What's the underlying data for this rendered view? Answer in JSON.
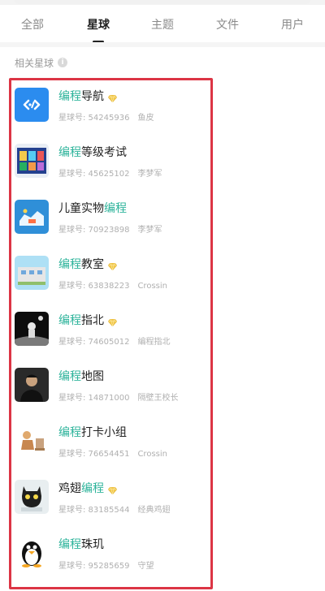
{
  "tabs": [
    {
      "label": "全部",
      "active": false
    },
    {
      "label": "星球",
      "active": true
    },
    {
      "label": "主题",
      "active": false
    },
    {
      "label": "文件",
      "active": false
    },
    {
      "label": "用户",
      "active": false
    }
  ],
  "section": {
    "title": "相关星球",
    "info_icon": "info-icon"
  },
  "keyword_color": "#2cb39a",
  "highlight_color": "#dc3545",
  "planets": [
    {
      "pre": "",
      "kw": "编程",
      "post": "导航",
      "diamond": true,
      "id_label": "星球号: 54245936",
      "owner": "鱼皮"
    },
    {
      "pre": "",
      "kw": "编程",
      "post": "等级考试",
      "diamond": false,
      "id_label": "星球号: 45625102",
      "owner": "李梦军"
    },
    {
      "pre": "儿童实物",
      "kw": "编程",
      "post": "",
      "diamond": false,
      "id_label": "星球号: 70923898",
      "owner": "李梦军"
    },
    {
      "pre": "",
      "kw": "编程",
      "post": "教室",
      "diamond": true,
      "id_label": "星球号: 63838223",
      "owner": "Crossin"
    },
    {
      "pre": "",
      "kw": "编程",
      "post": "指北",
      "diamond": true,
      "id_label": "星球号: 74605012",
      "owner": "编程指北"
    },
    {
      "pre": "",
      "kw": "编程",
      "post": "地图",
      "diamond": false,
      "id_label": "星球号: 14871000",
      "owner": "隔壁王校长"
    },
    {
      "pre": "",
      "kw": "编程",
      "post": "打卡小组",
      "diamond": false,
      "id_label": "星球号: 76654451",
      "owner": "Crossin"
    },
    {
      "pre": "鸡翅",
      "kw": "编程",
      "post": "",
      "diamond": true,
      "id_label": "星球号: 83185544",
      "owner": "经典鸡翅"
    },
    {
      "pre": "",
      "kw": "编程",
      "post": "珠玑",
      "diamond": false,
      "id_label": "星球号: 95285659",
      "owner": "守望"
    }
  ]
}
